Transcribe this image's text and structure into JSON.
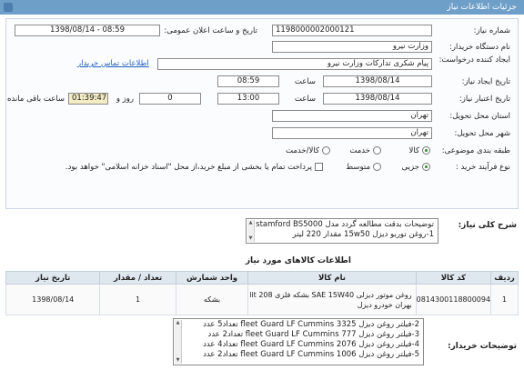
{
  "header": {
    "title": "جزئیات اطلاعات نیاز"
  },
  "form": {
    "need_number_label": "شماره نیاز:",
    "need_number": "1198000002000121",
    "announce_label": "تاریخ و ساعت اعلان عمومی:",
    "announce_value": "1398/08/14 - 08:59",
    "buyer_org_label": "نام دستگاه خریدار:",
    "buyer_org": "وزارت نیرو",
    "requester_label": "ایجاد کننده درخواست:",
    "requester": "پیام شکری تدارکات وزارت نیرو",
    "contact_link": "اطلاعات تماس خریدار",
    "created_label": "تاریخ ایجاد نیاز:",
    "created_date": "1398/08/14",
    "time_label": "ساعت",
    "created_time": "08:59",
    "deadline_label": "تاریخ اعتبار نیاز:",
    "deadline_date": "1398/08/14",
    "deadline_time": "13:00",
    "day_label": "روز و",
    "days": "0",
    "remaining_time": "01:39:47",
    "remaining_label": "ساعت باقی مانده",
    "province_label": "استان محل تحویل:",
    "province": "تهران",
    "city_label": "شهر محل تحویل:",
    "city": "تهران",
    "category_label": "طبقه بندی موضوعی:",
    "cat_goods": "کالا",
    "cat_service": "خدمت",
    "cat_both": "کالا/خدمت",
    "purchase_label": "نوع فرآیند خرید :",
    "purchase_partial": "جزیی",
    "purchase_medium": "متوسط",
    "payment_note": "پرداخت تمام یا بخشی از مبلغ خرید،از محل \"اسناد خزانه اسلامی\" خواهد بود."
  },
  "summary": {
    "title": "شرح کلی نیاز:",
    "lines": [
      "توضیحات بدقت مطالعه گردد مدل stamford BS5000",
      "1-روغن توربو دیزل 15w50 مقدار 220 لیتر"
    ]
  },
  "items": {
    "title": "اطلاعات کالاهای مورد نیاز",
    "columns": [
      "ردیف",
      "کد کالا",
      "نام کالا",
      "واحد شمارش",
      "تعداد / مقدار",
      "تاریخ نیاز"
    ],
    "rows": [
      {
        "row": "1",
        "code": "0814300118800094",
        "name": "روغن موتور دیزلی SAE 15W40 بشکه فلزی 208 lit بهران خودرو دیزل",
        "unit": "بشکه",
        "qty": "1",
        "date": "1398/08/14"
      }
    ]
  },
  "buyer_notes": {
    "title": "توضیحات خریدار:",
    "lines": [
      "2-فیلتر روغن دیزل fleet Guard LF Cummins 3325 تعداد5 عدد",
      "3-فیلتر روغن دیزل fleet Guard LF Cummins 777 تعداد2 عدد",
      "4-فیلتر روغن دیزل fleet Guard LF Cummins 2076 تعداد4 عدد",
      "5-فیلتر روغن دیزل fleet Guard LF Cummins 1006 تعداد2 عدد"
    ]
  }
}
